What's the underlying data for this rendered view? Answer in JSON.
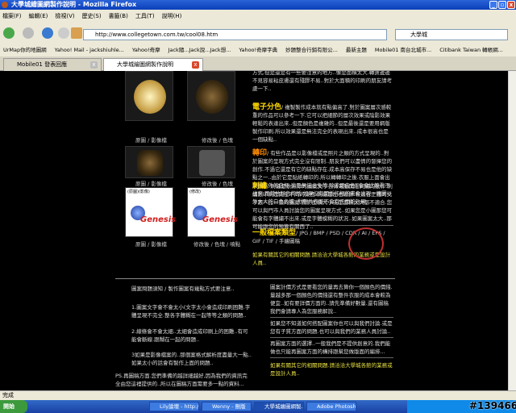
{
  "window": {
    "title": "大學城繪圖網製作說明 - Mozilla Firefox"
  },
  "menu": [
    "檔案(F)",
    "編輯(E)",
    "檢視(V)",
    "歷史(S)",
    "書籤(B)",
    "工具(T)",
    "說明(H)"
  ],
  "address": "http://www.collegetown.com.tw/cool08.htm",
  "search": "大學城",
  "bookmarks": [
    "UrMap你的地圖網",
    "Yahoo! Mail - jackshiuhle...",
    "Yahoo!奇摩",
    "Jack隨...Jack說...Jack想...",
    "Yahoo!奇摩字典",
    "妙題整合行銷有限公...",
    "最新主題",
    "Mobile01 南台北城市...",
    "Citibank Taiwan 轉帳網..."
  ],
  "tabs": [
    {
      "label": "Mobile01 發表回應"
    },
    {
      "label": "大學城繪圖網製作說明"
    }
  ],
  "gallery": {
    "captions": [
      "原圖 / 影像檔",
      "修改後 / 色塊",
      "原圖 / 影像檔",
      "修改後 / 色塊",
      "原圖 / 影像檔",
      "修改後 / 色塊 / 噴點"
    ],
    "logo_text": "Genesis",
    "labels": [
      "(原圖)(影像)",
      "(修改)"
    ]
  },
  "right": {
    "intro": "方式,但是還是有一些要注意的地方..像是面積太大.轉燙邊邊不見容易粘皮膚還有殘膠不易..對於大面積的印刷的朋友請考慮一下..",
    "s1_title": "電子分色",
    "s1_text": "/ 複製製作成本就有點偏高了.對於圖案層次感較重的作品可以參考一下.它可以把細節的層次效果或陰影效果輕鬆的表達出來..但是顏色是複雜的..但是最後還是要用網版製作印刷.所以效果還是無法完全的表現出來..成本很高也是一個缺點..",
    "s2_title": "轉印",
    "s2_text": "/ 有些作品是以影像檔或是照片之類的方式呈現的..對於圖案的呈現方式完全沒有限制..朋友們可以盡情的發揮您的創作.不過它還是有它的缺點存在.成本高保存不易也是他的缺點之一..由於它是貼紙轉印的.所以轉轉印之後.衣服上面會出現圖以外的白框.這是無法必免的.除非用白色T會會比較看不出來.用其他顏色的話.如果沒有開版作框的畫會出現一塊圖以外大大的白色色塊..對整件衣服不會有正面的效果...",
    "s3_title": "刺繡",
    "s3_text": "/ 刺繡是依照你的圖案文字去做電腦開版刺繡的動作.刺繡跟印刷是完全不同的東西.刺繡是左右線針.較適合正體的文字跟一比一畫的圖案.對於面積大小或是面積太大都不適合.您可以與門市人員討論您的圖案呈現方式..如果您是小圖那您可能會有字體繡不出來.或是字體模糊的狀況..如果圖案太大..那可能跟您的預算有關西了..",
    "ft_title": "一般檔案類型",
    "ft_text": "/ JPG / BMP / PSD / CDR / AI / EPS / GIF / TIF / 手繪圖稿",
    "contact": "如果有關其它的相關問題.請洽洽大學城各館的業務或是設計人員.."
  },
  "lower_left": {
    "title": "圖案問題須知 / 製作圖案有幾點方式要注意..",
    "p1": "1.圖案文字會不會太小(文字太小會造成印刷困難.字體呈現不完全.整各字體糊在一起等等之類的問題..",
    "p2": "2.線條會不會太細..太細會造成印刷上的困難..有可能會斷線.跟糊在一起的問題..",
    "p3": "3如果是影像檔案的..那個案格式解析度盡量大一點..如果太小的話會有製作上面的問題..",
    "ps": "PS.再圖稿方面.您們準備的越詳細越好,因為我們的資訊完全由您這裡提供的..所以在圖稿方面需要多一點的資料..."
  },
  "lower_right": {
    "p1": "圖案計價方式是要看您的量再去算你一個顏色的價錢.量越多那一個顏色的價錢還有整件衣服的成本會較為便宜..如有要詳價方面的..請先準備好數量.還有圖稿我們會請專人為您服務解說..",
    "p2": "如果您不知道如何搭配圖案你也可以與我們討論.或是您有子質方面的問題.也可以與我們的業務人員討論..",
    "p3": "再圖案方面的選擇..一般我們是不提供創意的.我們能做也只能再圖案方面的構排跟幫您做版面的編排...",
    "contact": "如果有關其它的相關問題.請洽洽大學城各館的業務或是設計人員.."
  },
  "status": "完成",
  "taskbar": {
    "start": "開始",
    "tasks": [
      "Lily論壇 - http://61...",
      "Wenny - 刪版",
      "大學城繪圖網製...",
      "Adobe Photoshop"
    ]
  },
  "watermark": "#139466"
}
